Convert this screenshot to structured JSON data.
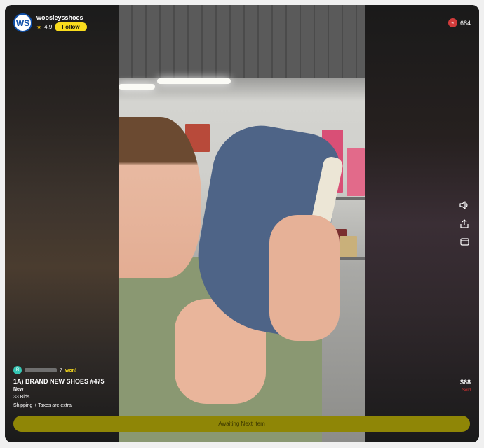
{
  "stream": {
    "username": "woosleysshoes",
    "avatar_text": "WS",
    "rating": "4.9",
    "follow_label": "Follow",
    "viewer_badge": "∞",
    "viewer_count": "684"
  },
  "auction": {
    "winner_avatar": "R",
    "winner_name_tail": "7",
    "won_label": "won!",
    "title": "1A) BRAND NEW SHOES #475",
    "condition": "New",
    "bids": "33 Bids",
    "shipping": "Shipping + Taxes are extra",
    "price": "$68",
    "status": "Sold",
    "cta_label": "Awaiting Next Item"
  },
  "icons": [
    "star-icon",
    "speaker-icon",
    "share-icon",
    "wallet-icon"
  ],
  "colors": {
    "accent": "#f9dc1d",
    "cta_bg": "#8f8606",
    "sold": "#dd3333",
    "live": "#d23b3b"
  }
}
